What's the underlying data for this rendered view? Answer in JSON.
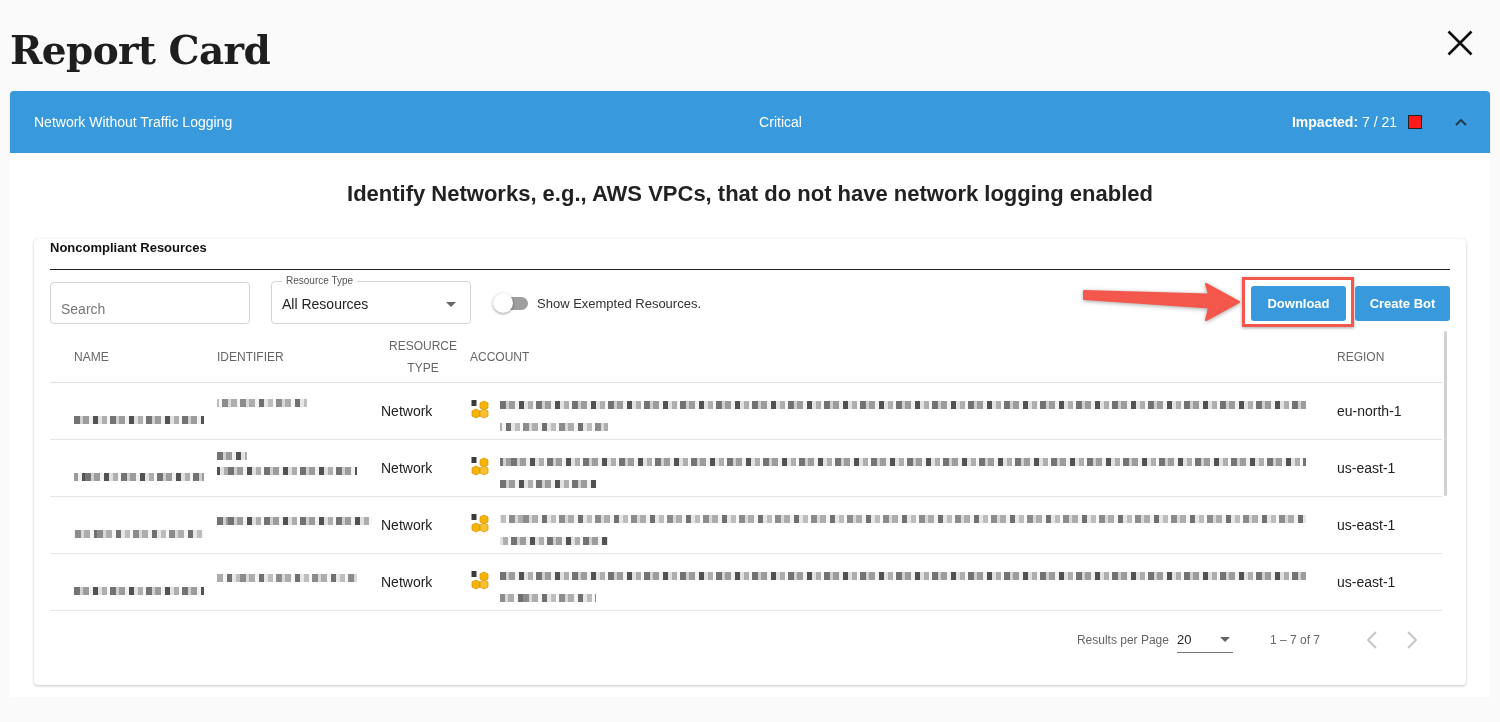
{
  "page": {
    "title": "Report Card"
  },
  "issue": {
    "name": "Network Without Traffic Logging",
    "severity": "Critical",
    "impacted": "**Impacted:** 7 / 21",
    "expanded": true,
    "description": "Identify Networks, e.g., AWS VPCs, that do not have network logging enabled"
  },
  "resources": {
    "title": "Noncompliant Resources",
    "search": {
      "placeholder": "Search"
    },
    "resource_type": {
      "label": "Resource Type",
      "value": "All Resources"
    },
    "exempted_toggle": {
      "label": "Show Exempted Resources.",
      "on": false
    },
    "buttons": [
      {
        "label": "Download",
        "highlighted": true
      },
      {
        "label": "Create Bot",
        "highlighted": false
      }
    ],
    "columns": [
      "NAME",
      "IDENTIFIER",
      "RESOURCE TYPE",
      "ACCOUNT",
      "REGION"
    ],
    "rows": [
      {
        "resource_type": "Network",
        "region": "eu-north-1"
      },
      {
        "resource_type": "Network",
        "region": "us-east-1"
      },
      {
        "resource_type": "Network",
        "region": "us-east-1"
      },
      {
        "resource_type": "Network",
        "region": "us-east-1"
      }
    ],
    "pagination": {
      "per_page_label": "Results per Page",
      "per_page": "20",
      "range": "1 – 7 of 7",
      "previous": {
        "disabled": true
      },
      "next": {
        "disabled": true
      }
    }
  }
}
